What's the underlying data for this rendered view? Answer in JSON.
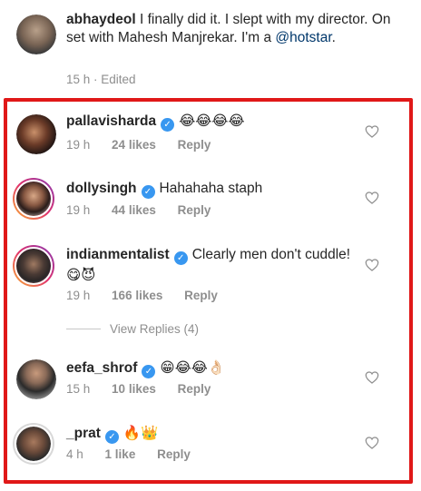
{
  "caption": {
    "username": "abhaydeol",
    "text": "I finally did it. I slept with my director. On set with Mahesh Manjrekar. I'm a ",
    "mention": "@hotstar",
    "suffix": ".",
    "time": "15 h",
    "edited": "Edited",
    "separator": " · "
  },
  "comments": [
    {
      "username": "pallavisharda",
      "text": "😂😂😂😂",
      "time": "19 h",
      "likes": "24 likes",
      "reply": "Reply"
    },
    {
      "username": "dollysingh",
      "text": "Hahahaha staph",
      "time": "19 h",
      "likes": "44 likes",
      "reply": "Reply"
    },
    {
      "username": "indianmentalist",
      "text": "Clearly men don't cuddle!",
      "text2": "😋😈",
      "time": "19 h",
      "likes": "166 likes",
      "reply": "Reply"
    },
    {
      "username": "eefa_shrof",
      "text": "😁😂😂👌🏻",
      "time": "15 h",
      "likes": "10 likes",
      "reply": "Reply"
    },
    {
      "username": "_prat",
      "text": "🔥👑",
      "time": "4 h",
      "likes": "1 like",
      "reply": "Reply"
    }
  ],
  "view_replies": "View Replies (4)",
  "colors": {
    "highlight": "#e01818",
    "verified": "#3897f0",
    "meta": "#8e8e8e",
    "mention": "#00376b"
  },
  "icons": [
    "heart-icon",
    "verified-badge-icon"
  ]
}
